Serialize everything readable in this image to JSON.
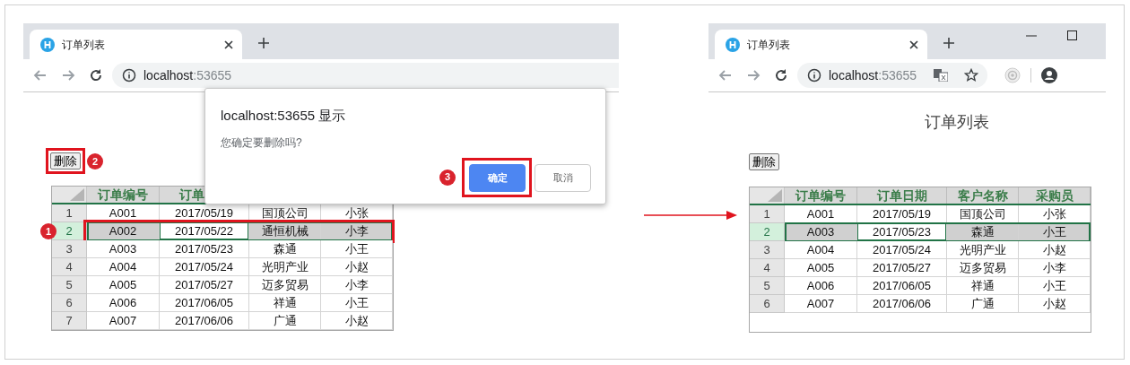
{
  "panels": [
    {
      "kind": "cropped",
      "tab": {
        "title": "订单列表"
      },
      "address": {
        "host": "localhost",
        "port": ":53655"
      },
      "delete_button": {
        "label": "删除",
        "annotation": "2"
      },
      "table": {
        "columns": [
          {
            "label": "订单编号",
            "cut": false
          },
          {
            "label": "订单",
            "cut": true
          }
        ],
        "rows": [
          {
            "number": "1",
            "selected": false,
            "cells": [
              {
                "text": "A001",
                "active": false
              },
              {
                "text": "2017/05/19",
                "active": false
              },
              {
                "text": "国顶公司",
                "active": false
              },
              {
                "text": "小张",
                "active": false
              }
            ]
          },
          {
            "number": "2",
            "selected": true,
            "annotation": "1",
            "cells": [
              {
                "text": "A002",
                "active": false
              },
              {
                "text": "2017/05/22",
                "active": true
              },
              {
                "text": "通恒机械",
                "active": false
              },
              {
                "text": "小李",
                "active": false
              }
            ]
          },
          {
            "number": "3",
            "selected": false,
            "cells": [
              {
                "text": "A003",
                "active": false
              },
              {
                "text": "2017/05/23",
                "active": false
              },
              {
                "text": "森通",
                "active": false
              },
              {
                "text": "小王",
                "active": false
              }
            ]
          },
          {
            "number": "4",
            "selected": false,
            "cells": [
              {
                "text": "A004",
                "active": false
              },
              {
                "text": "2017/05/24",
                "active": false
              },
              {
                "text": "光明产业",
                "active": false
              },
              {
                "text": "小赵",
                "active": false
              }
            ]
          },
          {
            "number": "5",
            "selected": false,
            "cells": [
              {
                "text": "A005",
                "active": false
              },
              {
                "text": "2017/05/27",
                "active": false
              },
              {
                "text": "迈多贸易",
                "active": false
              },
              {
                "text": "小李",
                "active": false
              }
            ]
          },
          {
            "number": "6",
            "selected": false,
            "cells": [
              {
                "text": "A006",
                "active": false
              },
              {
                "text": "2017/06/05",
                "active": false
              },
              {
                "text": "祥通",
                "active": false
              },
              {
                "text": "小王",
                "active": false
              }
            ]
          },
          {
            "number": "7",
            "selected": false,
            "cells": [
              {
                "text": "A007",
                "active": false
              },
              {
                "text": "2017/06/06",
                "active": false
              },
              {
                "text": "广通",
                "active": false
              },
              {
                "text": "小赵",
                "active": false
              }
            ]
          }
        ]
      },
      "dialog": {
        "title": "localhost:53655 显示",
        "message": "您确定要删除吗?",
        "buttons": [
          {
            "label": "确定",
            "kind": "primary",
            "annotation": "3"
          },
          {
            "label": "取消",
            "kind": "secondary"
          }
        ]
      }
    },
    {
      "kind": "full",
      "tab": {
        "title": "订单列表"
      },
      "address": {
        "host": "localhost",
        "port": ":53655"
      },
      "page_title": "订单列表",
      "delete_button": {
        "label": "删除"
      },
      "table": {
        "columns": [
          {
            "label": "订单编号"
          },
          {
            "label": "订单日期"
          },
          {
            "label": "客户名称"
          },
          {
            "label": "采购员"
          }
        ],
        "rows": [
          {
            "number": "1",
            "selected": false,
            "cells": [
              {
                "text": "A001",
                "active": false
              },
              {
                "text": "2017/05/19",
                "active": false
              },
              {
                "text": "国顶公司",
                "active": false
              },
              {
                "text": "小张",
                "active": false
              }
            ]
          },
          {
            "number": "2",
            "selected": true,
            "cells": [
              {
                "text": "A003",
                "active": false
              },
              {
                "text": "2017/05/23",
                "active": true
              },
              {
                "text": "森通",
                "active": false
              },
              {
                "text": "小王",
                "active": false
              }
            ]
          },
          {
            "number": "3",
            "selected": false,
            "cells": [
              {
                "text": "A004",
                "active": false
              },
              {
                "text": "2017/05/24",
                "active": false
              },
              {
                "text": "光明产业",
                "active": false
              },
              {
                "text": "小赵",
                "active": false
              }
            ]
          },
          {
            "number": "4",
            "selected": false,
            "cells": [
              {
                "text": "A005",
                "active": false
              },
              {
                "text": "2017/05/27",
                "active": false
              },
              {
                "text": "迈多贸易",
                "active": false
              },
              {
                "text": "小李",
                "active": false
              }
            ]
          },
          {
            "number": "5",
            "selected": false,
            "cells": [
              {
                "text": "A006",
                "active": false
              },
              {
                "text": "2017/06/05",
                "active": false
              },
              {
                "text": "祥通",
                "active": false
              },
              {
                "text": "小王",
                "active": false
              }
            ]
          },
          {
            "number": "6",
            "selected": false,
            "cells": [
              {
                "text": "A007",
                "active": false
              },
              {
                "text": "2017/06/06",
                "active": false
              },
              {
                "text": "广通",
                "active": false
              },
              {
                "text": "小赵",
                "active": false
              }
            ]
          }
        ]
      }
    }
  ]
}
